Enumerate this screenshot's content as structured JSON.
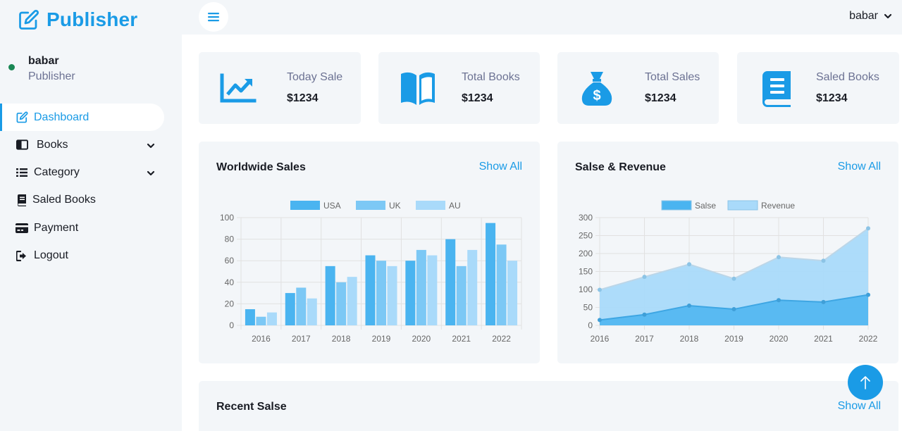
{
  "brand": {
    "name": "Publisher"
  },
  "user": {
    "name": "babar",
    "role": "Publisher"
  },
  "nav": [
    {
      "label": "Dashboard",
      "icon": "edit-icon",
      "active": true,
      "dropdown": false
    },
    {
      "label": "Books",
      "icon": "book-icon",
      "active": false,
      "dropdown": true
    },
    {
      "label": "Category",
      "icon": "list-icon",
      "active": false,
      "dropdown": true
    },
    {
      "label": "Saled Books",
      "icon": "book-solid-icon",
      "active": false,
      "dropdown": false
    },
    {
      "label": "Payment",
      "icon": "credit-card-icon",
      "active": false,
      "dropdown": false
    },
    {
      "label": "Logout",
      "icon": "sign-out-icon",
      "active": false,
      "dropdown": false
    }
  ],
  "topbar": {
    "user_name": "babar"
  },
  "stats": [
    {
      "label": "Today Sale",
      "value": "$1234",
      "icon": "chart-line-icon"
    },
    {
      "label": "Total Books",
      "value": "$1234",
      "icon": "open-book-icon"
    },
    {
      "label": "Total Sales",
      "value": "$1234",
      "icon": "money-bag-icon"
    },
    {
      "label": "Saled Books",
      "value": "$1234",
      "icon": "book-icon"
    }
  ],
  "cards": {
    "worldwide": {
      "title": "Worldwide Sales",
      "show_all": "Show All"
    },
    "revenue": {
      "title": "Salse & Revenue",
      "show_all": "Show All"
    },
    "recent": {
      "title": "Recent Salse",
      "show_all": "Show All"
    }
  },
  "colors": {
    "accent": "#1a9be6",
    "bg": "#f3f6f9"
  },
  "chart_data": [
    {
      "type": "bar",
      "title": "",
      "categories": [
        "2016",
        "2017",
        "2018",
        "2019",
        "2020",
        "2021",
        "2022"
      ],
      "series": [
        {
          "name": "USA",
          "values": [
            15,
            30,
            55,
            65,
            60,
            80,
            95
          ],
          "color": "#4ab4f0"
        },
        {
          "name": "UK",
          "values": [
            8,
            35,
            40,
            60,
            70,
            55,
            75
          ],
          "color": "#7cc8f5"
        },
        {
          "name": "AU",
          "values": [
            12,
            25,
            45,
            55,
            65,
            70,
            60
          ],
          "color": "#a9dafa"
        }
      ],
      "ylim": [
        0,
        100
      ],
      "yticks": [
        0,
        20,
        40,
        60,
        80,
        100
      ],
      "legend": "top",
      "grid": true
    },
    {
      "type": "area",
      "title": "",
      "categories": [
        "2016",
        "2017",
        "2018",
        "2019",
        "2020",
        "2021",
        "2022"
      ],
      "series": [
        {
          "name": "Salse",
          "values": [
            15,
            30,
            55,
            45,
            70,
            65,
            85
          ],
          "color": "#4ab4f0"
        },
        {
          "name": "Revenue",
          "values": [
            99,
            135,
            170,
            130,
            190,
            180,
            270
          ],
          "color": "#a9dafa"
        }
      ],
      "ylim": [
        0,
        300
      ],
      "yticks": [
        0,
        50,
        100,
        150,
        200,
        250,
        300
      ],
      "legend": "top",
      "grid": true
    }
  ]
}
